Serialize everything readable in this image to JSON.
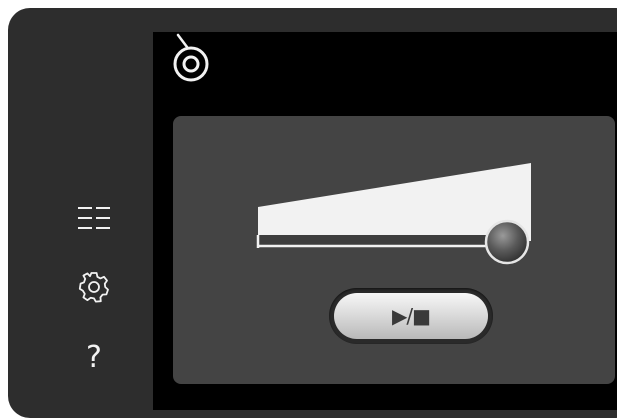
{
  "sidebar": {
    "items": [
      {
        "icon": "list-icon"
      },
      {
        "icon": "gear-icon"
      },
      {
        "icon": "help-icon",
        "label": "?"
      }
    ]
  },
  "header": {
    "icon": "spool-icon"
  },
  "volume": {
    "icon": "volume-slider",
    "level": 0.94
  },
  "playback": {
    "icon": "play-stop-icon",
    "label": "▶/■"
  },
  "colors": {
    "device": "#2d2d2d",
    "screen": "#000000",
    "panel": "#444444",
    "foreground": "#f2f2f2"
  }
}
